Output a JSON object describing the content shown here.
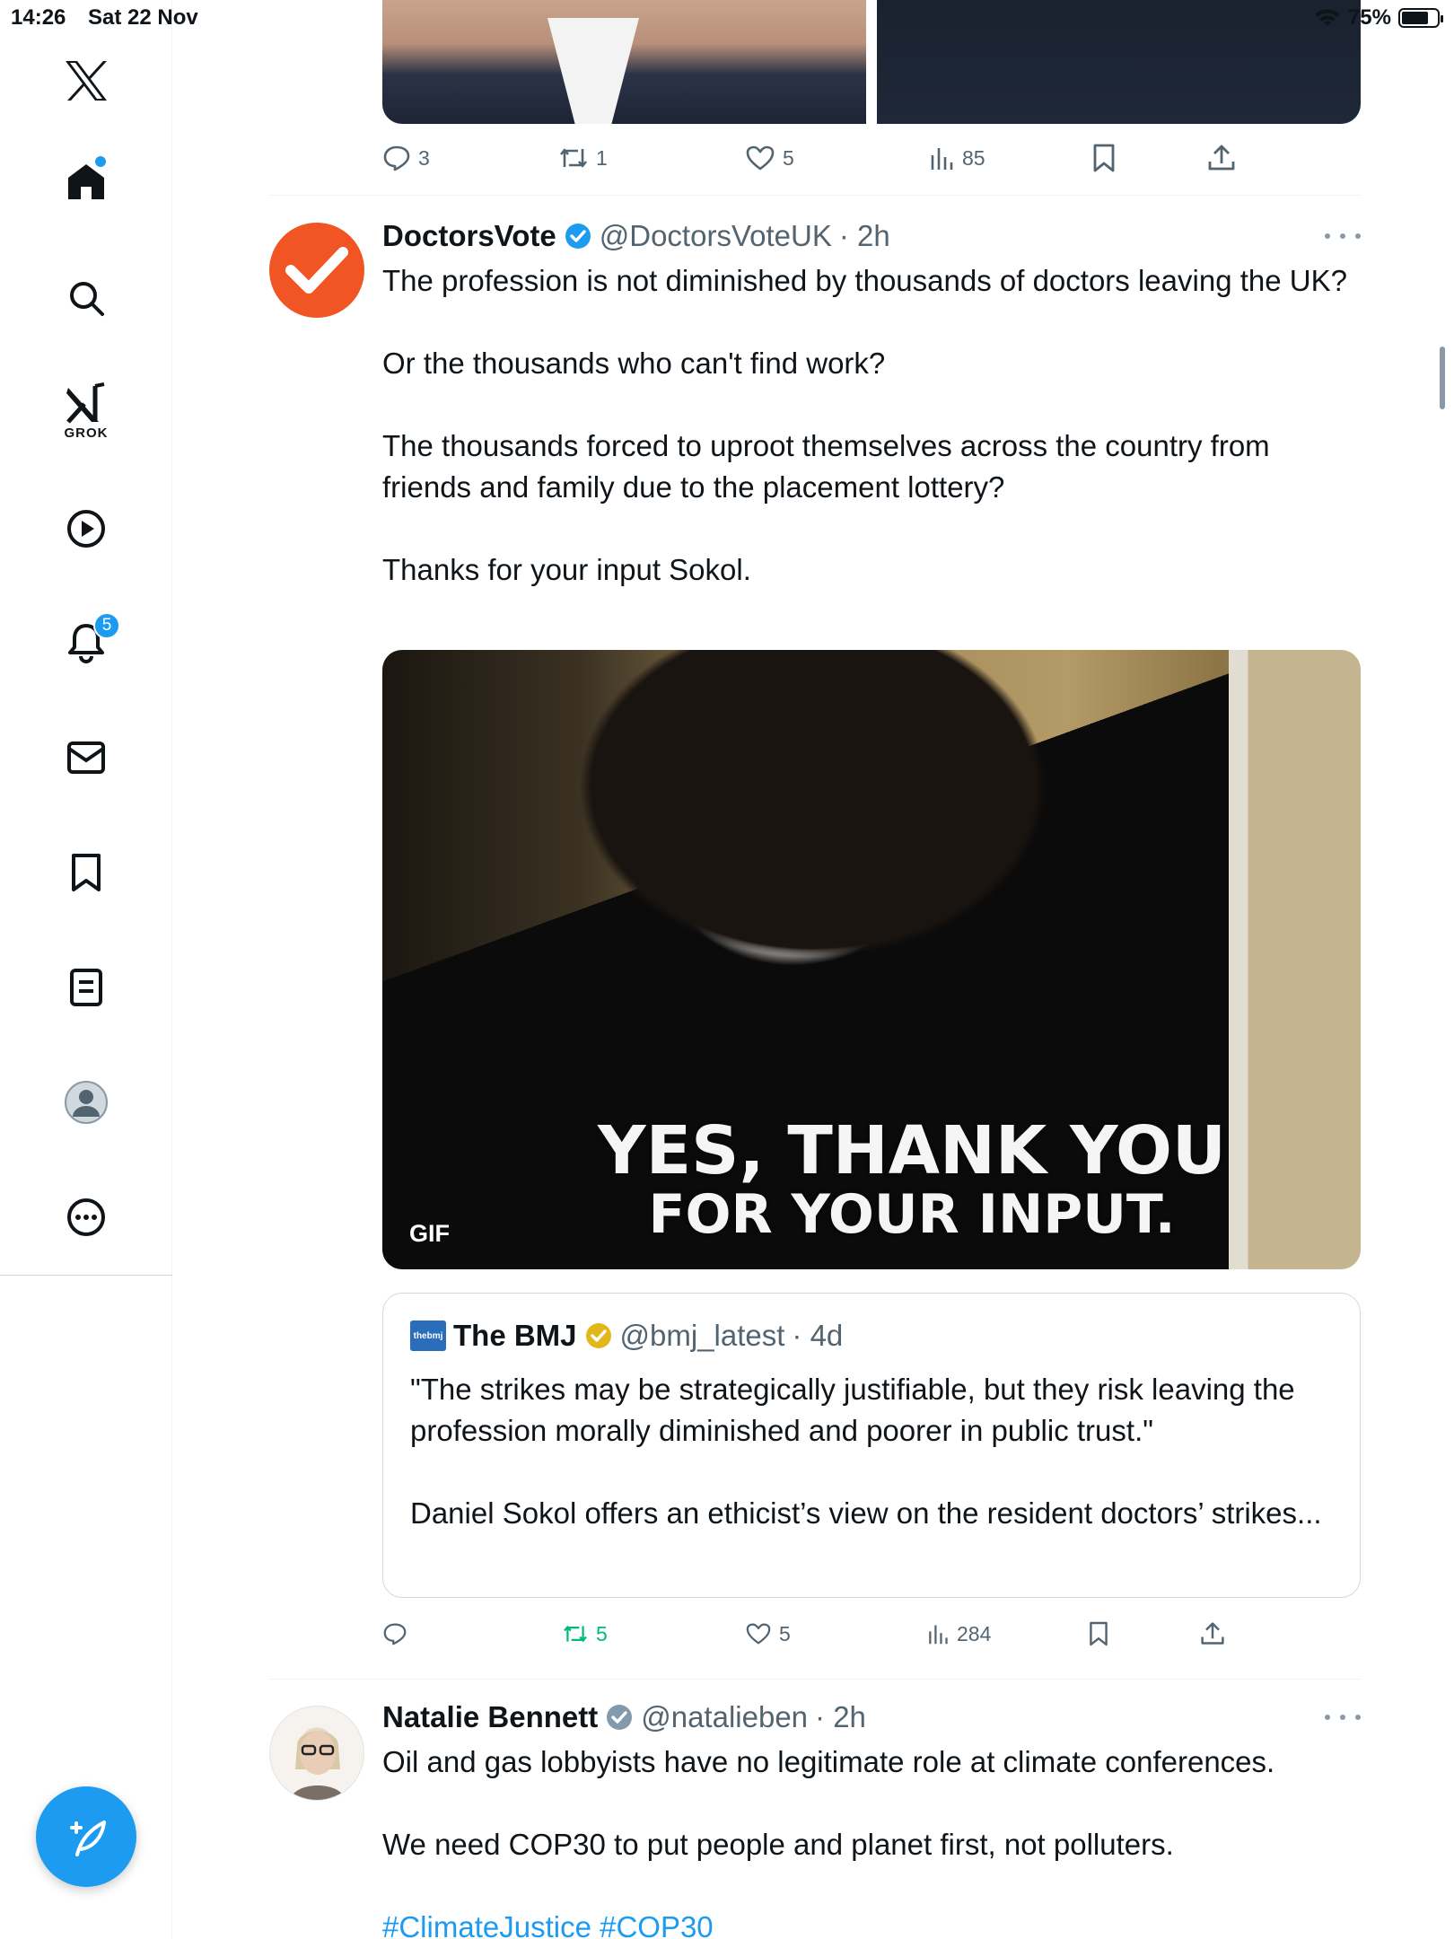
{
  "status_bar": {
    "time": "14:26",
    "date": "Sat 22 Nov",
    "battery": "75%",
    "battery_level": 0.75
  },
  "sidebar": {
    "grok_label": "GROK",
    "notification_count": "5"
  },
  "prev_tweet_actions": {
    "replies": "3",
    "reposts": "1",
    "likes": "5",
    "views": "85"
  },
  "tweet1": {
    "author": "DoctorsVote",
    "handle": "@DoctorsVoteUK",
    "time": "· 2h",
    "text": "The profession is not diminished by thousands of doctors leaving the UK?\n\nOr the thousands who can't find work?\n\nThe thousands forced to uproot themselves across the country from friends and family due to the placement lottery?\n\nThanks for your input Sokol.",
    "gif": {
      "caption_line1": "YES, THANK YOU",
      "caption_line2": "FOR YOUR INPUT.",
      "label": "GIF"
    },
    "quote": {
      "logo_text": "thebmj",
      "author": "The BMJ",
      "handle": "@bmj_latest",
      "time": "· 4d",
      "text": "\"The strikes may be strategically justifiable, but they risk leaving the profession morally diminished and poorer in public trust.\"\n\nDaniel Sokol offers an ethicist’s view on the resident doctors’ strikes..."
    },
    "actions": {
      "replies": "",
      "reposts": "5",
      "likes": "5",
      "views": "284"
    }
  },
  "tweet2": {
    "author": "Natalie Bennett",
    "handle": "@natalieben",
    "time": "· 2h",
    "text": "Oil and gas lobbyists have no legitimate role at climate conferences.\n\nWe need COP30 to put people and planet first, not polluters.",
    "hashtags": "#ClimateJustice #COP30"
  },
  "colors": {
    "accent": "#1d9bf0",
    "repost_active": "#00ba7c",
    "verified_blue": "#1d9bf0",
    "verified_gold": "#e2b719",
    "doctorsvote_brand": "#f05523"
  }
}
